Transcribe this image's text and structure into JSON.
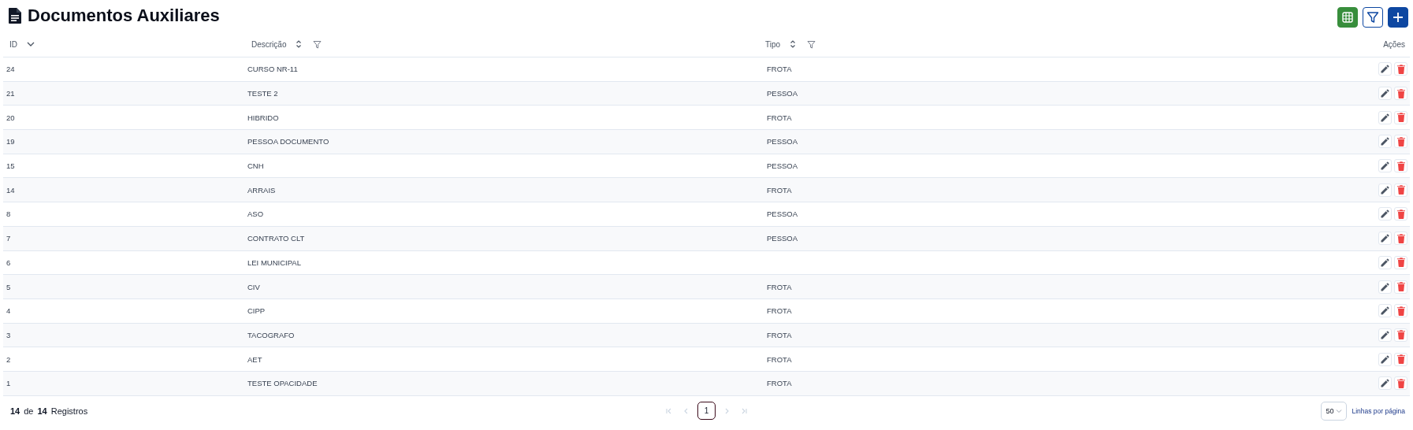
{
  "title": "Documentos Auxiliares",
  "toolbar": [
    {
      "kind": "spreadsheet"
    },
    {
      "kind": "filter"
    },
    {
      "kind": "add"
    }
  ],
  "table": {
    "columns": [
      {
        "label": "ID",
        "kind": "sorted",
        "filter": false
      },
      {
        "label": "Descrição",
        "kind": "sortable",
        "filter": true
      },
      {
        "label": "Tipo",
        "kind": "sortable",
        "filter": true
      },
      {
        "label": "Ações",
        "kind": "plain",
        "filter": false
      }
    ],
    "rows": [
      {
        "id": "24",
        "descricao": "CURSO NR-11",
        "tipo": "FROTA"
      },
      {
        "id": "21",
        "descricao": "TESTE 2",
        "tipo": "PESSOA"
      },
      {
        "id": "20",
        "descricao": "HIBRIDO",
        "tipo": "FROTA"
      },
      {
        "id": "19",
        "descricao": "PESSOA DOCUMENTO",
        "tipo": "PESSOA"
      },
      {
        "id": "15",
        "descricao": "CNH",
        "tipo": "PESSOA"
      },
      {
        "id": "14",
        "descricao": "ARRAIS",
        "tipo": "FROTA"
      },
      {
        "id": "8",
        "descricao": "ASO",
        "tipo": "PESSOA"
      },
      {
        "id": "7",
        "descricao": "CONTRATO CLT",
        "tipo": "PESSOA"
      },
      {
        "id": "6",
        "descricao": "LEI MUNICIPAL"
      },
      {
        "id": "5",
        "descricao": "CIV",
        "tipo": "FROTA"
      },
      {
        "id": "4",
        "descricao": "CIPP",
        "tipo": "FROTA"
      },
      {
        "id": "3",
        "descricao": "TACOGRAFO",
        "tipo": "FROTA"
      },
      {
        "id": "2",
        "descricao": "AET",
        "tipo": "FROTA"
      },
      {
        "id": "1",
        "descricao": "TESTE OPACIDADE",
        "tipo": "FROTA"
      }
    ]
  },
  "footer": {
    "shown": "14",
    "of": "de",
    "total": "14",
    "unit": "Registros",
    "pages": [
      {
        "label": "1",
        "selected": true
      }
    ],
    "page_size": "50",
    "page_size_label": "Linhas por página"
  }
}
